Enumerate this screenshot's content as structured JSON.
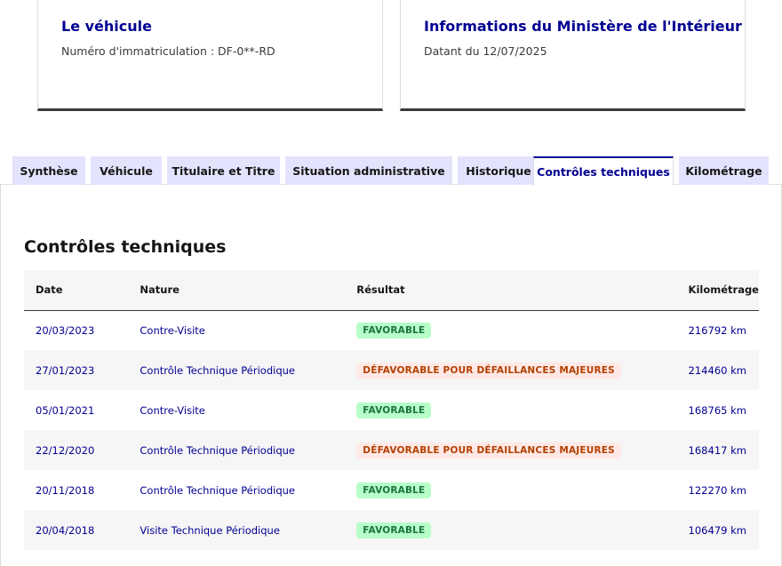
{
  "cards": [
    {
      "title": "Le véhicule",
      "desc": "Numéro d'immatriculation : DF-0**-RD"
    },
    {
      "title": "Informations du Ministère de l'Intérieur",
      "desc": "Datant du 12/07/2025"
    }
  ],
  "tabs": [
    {
      "label": "Synthèse"
    },
    {
      "label": "Véhicule"
    },
    {
      "label": "Titulaire et Titre"
    },
    {
      "label": "Situation administrative"
    },
    {
      "label": "Historique"
    },
    {
      "label": "Contrôles techniques"
    },
    {
      "label": "Kilométrage"
    }
  ],
  "active_tab": "Contrôles techniques",
  "section": {
    "title": "Contrôles techniques"
  },
  "table": {
    "headers": [
      "Date",
      "Nature",
      "Résultat",
      "Kilométrage"
    ],
    "rows": [
      {
        "date": "20/03/2023",
        "nature": "Contre-Visite",
        "result": "FAVORABLE",
        "km": "216792 km"
      },
      {
        "date": "27/01/2023",
        "nature": "Contrôle Technique Périodique",
        "result": "DÉFAVORABLE POUR DÉFAILLANCES MAJEURES",
        "km": "214460 km"
      },
      {
        "date": "05/01/2021",
        "nature": "Contre-Visite",
        "result": "FAVORABLE",
        "km": "168765 km"
      },
      {
        "date": "22/12/2020",
        "nature": "Contrôle Technique Périodique",
        "result": "DÉFAVORABLE POUR DÉFAILLANCES MAJEURES",
        "km": "168417 km"
      },
      {
        "date": "20/11/2018",
        "nature": "Contrôle Technique Périodique",
        "result": "FAVORABLE",
        "km": "122270 km"
      },
      {
        "date": "20/04/2018",
        "nature": "Visite Technique Périodique",
        "result": "FAVORABLE",
        "km": "106479 km"
      }
    ]
  },
  "colors": {
    "accent": "#000091",
    "tab_bg": "#e3e3fd",
    "success_bg": "#b8fec9",
    "success_text": "#18753c",
    "error_bg": "#ffe9e6",
    "error_text": "#b34000"
  }
}
